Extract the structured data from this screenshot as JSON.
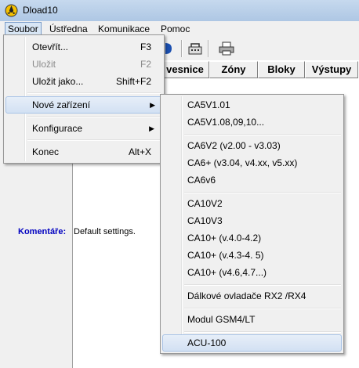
{
  "window": {
    "title": "Dload10"
  },
  "menubar": {
    "items": [
      "Soubor",
      "Ústředna",
      "Komunikace",
      "Pomoc"
    ]
  },
  "file_menu": {
    "open": {
      "label": "Otevřít...",
      "shortcut": "F3"
    },
    "save": {
      "label": "Uložit",
      "shortcut": "F2"
    },
    "save_as": {
      "label": "Uložit jako...",
      "shortcut": "Shift+F2"
    },
    "new_device": {
      "label": "Nové zařízení"
    },
    "configuration": {
      "label": "Konfigurace"
    },
    "exit": {
      "label": "Konec",
      "shortcut": "Alt+X"
    }
  },
  "submenu": {
    "items": [
      "CA5V1.01",
      "CA5V1.08,09,10...",
      "CA6V2 (v2.00 - v3.03)",
      "CA6+ (v3.04, v4.xx, v5.xx)",
      "CA6v6",
      "CA10V2",
      "CA10V3",
      "CA10+ (v.4.0-4.2)",
      "CA10+ (v.4.3-4. 5)",
      "CA10+ (v4.6,4.7...)",
      "Dálkové ovladače RX2 /RX4",
      "Modul GSM4/LT",
      "ACU-100"
    ]
  },
  "tabs": [
    "vesnice",
    "Zóny",
    "Bloky",
    "Výstupy"
  ],
  "comment": {
    "label": "Komentáře:",
    "value": "Default settings."
  },
  "icons": [
    "app-icon",
    "dial-icon",
    "modem-icon",
    "printer-icon"
  ]
}
